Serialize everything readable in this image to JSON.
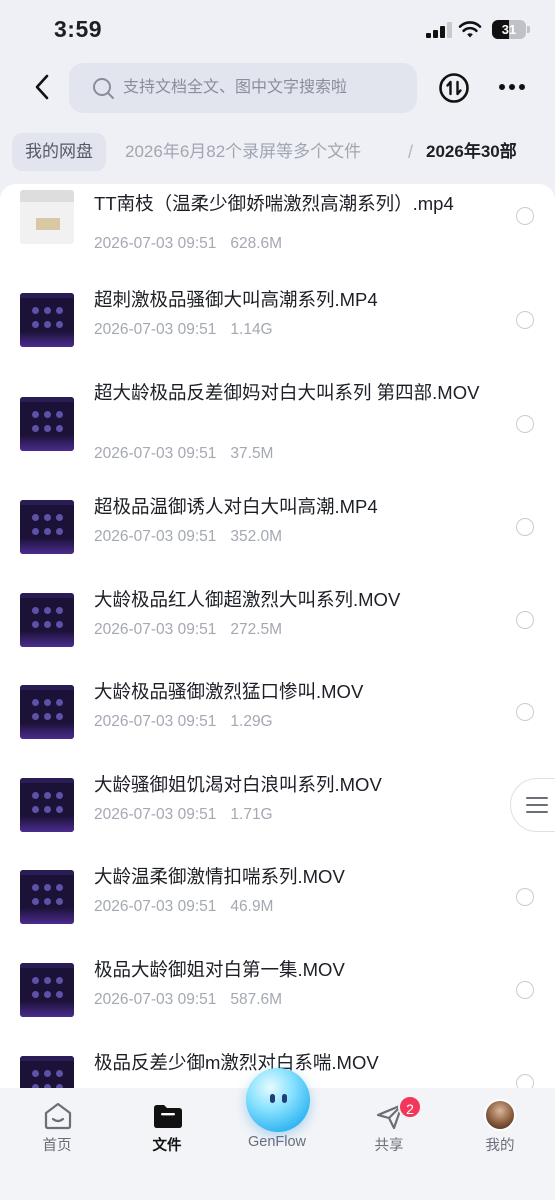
{
  "status_bar": {
    "time": "3:59",
    "battery": "31"
  },
  "header": {
    "search_placeholder": "支持文档全文、图中文字搜索啦"
  },
  "breadcrumb": {
    "root": "我的网盘",
    "middle": "2026年6月82个录屏等多个文件",
    "separator": "/",
    "current": "2026年30部"
  },
  "files": [
    {
      "name": "TT南枝（温柔少御娇喘激烈高潮系列）.mp4",
      "date": "2026-07-03 09:51",
      "size": "628.6M",
      "thumb": "light"
    },
    {
      "name": "超刺激极品骚御大叫高潮系列.MP4",
      "date": "2026-07-03 09:51",
      "size": "1.14G",
      "thumb": "dark"
    },
    {
      "name": "超大龄极品反差御妈对白大叫系列 第四部.MOV",
      "date": "2026-07-03 09:51",
      "size": "37.5M",
      "thumb": "dark"
    },
    {
      "name": "超极品温御诱人对白大叫高潮.MP4",
      "date": "2026-07-03 09:51",
      "size": "352.0M",
      "thumb": "dark"
    },
    {
      "name": "大龄极品红人御超激烈大叫系列.MOV",
      "date": "2026-07-03 09:51",
      "size": "272.5M",
      "thumb": "dark"
    },
    {
      "name": "大龄极品骚御激烈猛口惨叫.MOV",
      "date": "2026-07-03 09:51",
      "size": "1.29G",
      "thumb": "dark"
    },
    {
      "name": "大龄骚御姐饥渴对白浪叫系列.MOV",
      "date": "2026-07-03 09:51",
      "size": "1.71G",
      "thumb": "dark"
    },
    {
      "name": "大龄温柔御激情扣喘系列.MOV",
      "date": "2026-07-03 09:51",
      "size": "46.9M",
      "thumb": "dark"
    },
    {
      "name": "极品大龄御姐对白第一集.MOV",
      "date": "2026-07-03 09:51",
      "size": "587.6M",
      "thumb": "dark"
    },
    {
      "name": "极品反差少御m激烈对白系喘.MOV",
      "date": "",
      "size": "",
      "thumb": "dark"
    }
  ],
  "tabs": [
    {
      "label": "首页",
      "icon": "home-icon"
    },
    {
      "label": "文件",
      "icon": "folder-icon"
    },
    {
      "label": "GenFlow",
      "icon": "genflow-icon"
    },
    {
      "label": "共享",
      "icon": "send-icon"
    },
    {
      "label": "我的",
      "icon": "avatar"
    }
  ],
  "share_badge": "2",
  "colors": {
    "background": "#eef0f6",
    "badge": "#f2375a",
    "accent": "#35b7f2"
  }
}
